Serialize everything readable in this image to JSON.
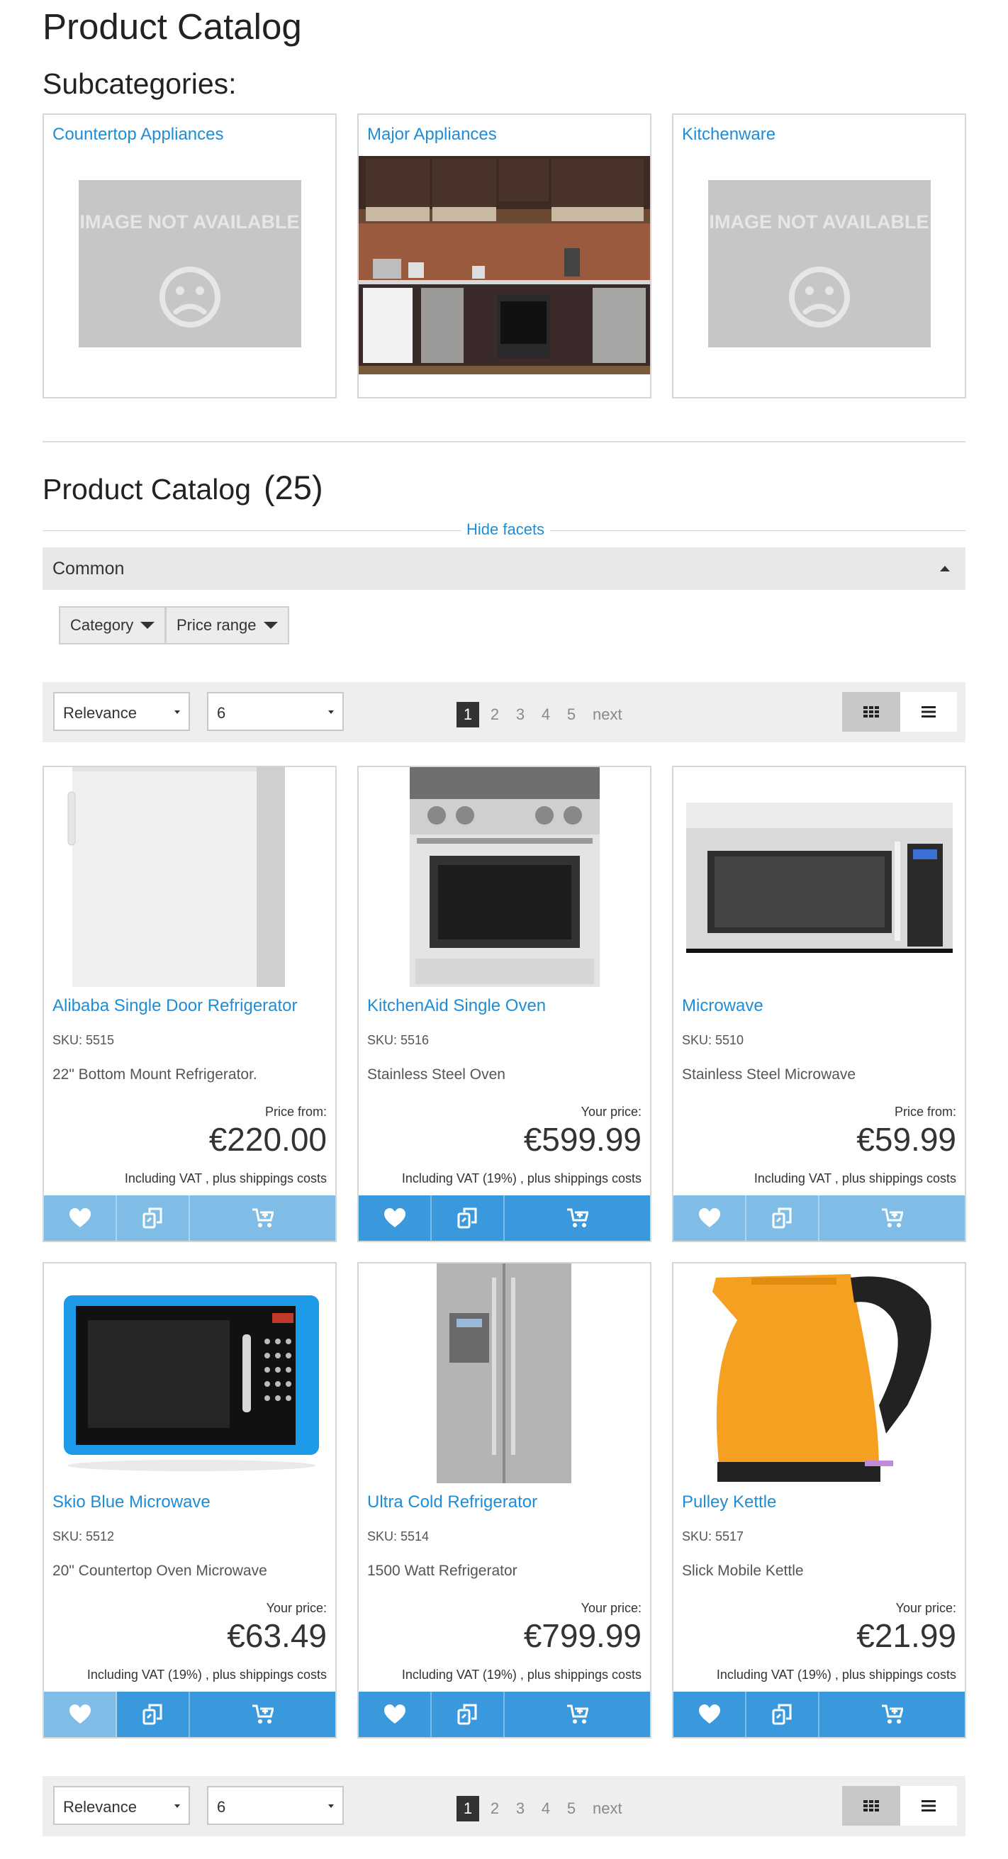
{
  "page_title": "Product Catalog",
  "subcategories_title": "Subcategories:",
  "subcategories": [
    {
      "name": "Countertop Appliances",
      "image": "not-available"
    },
    {
      "name": "Major Appliances",
      "image": "kitchen-photo"
    },
    {
      "name": "Kitchenware",
      "image": "not-available"
    }
  ],
  "image_not_available": "IMAGE NOT AVAILABLE",
  "catalog": {
    "heading": "Product Catalog",
    "count": "(25)"
  },
  "facets": {
    "hide_label": "Hide facets",
    "group_label": "Common",
    "buttons": [
      "Category",
      "Price range"
    ]
  },
  "toolbar": {
    "sort_value": "Relevance",
    "per_page_value": "6",
    "pages": [
      "1",
      "2",
      "3",
      "4",
      "5"
    ],
    "active_page": "1",
    "next_label": "next"
  },
  "products": [
    {
      "name": "Alibaba Single Door Refrigerator",
      "sku": "SKU: 5515",
      "description": "22\" Bottom Mount Refrigerator.",
      "price_label": "Price from:",
      "price": "€220.00",
      "vat_text": "Including VAT , plus shippings costs",
      "image": "white-fridge"
    },
    {
      "name": "KitchenAid Single Oven",
      "sku": "SKU: 5516",
      "description": "Stainless Steel Oven",
      "price_label": "Your price:",
      "price": "€599.99",
      "vat_text": "Including VAT (19%) , plus shippings costs",
      "image": "steel-oven"
    },
    {
      "name": "Microwave",
      "sku": "SKU: 5510",
      "description": "Stainless Steel Microwave",
      "price_label": "Price from:",
      "price": "€59.99",
      "vat_text": "Including VAT , plus shippings costs",
      "image": "steel-microwave"
    },
    {
      "name": "Skio Blue Microwave",
      "sku": "SKU: 5512",
      "description": "20\" Countertop Oven Microwave",
      "price_label": "Your price:",
      "price": "€63.49",
      "vat_text": "Including VAT (19%) , plus shippings costs",
      "image": "blue-microwave"
    },
    {
      "name": "Ultra Cold Refrigerator",
      "sku": "SKU: 5514",
      "description": "1500 Watt Refrigerator",
      "price_label": "Your price:",
      "price": "€799.99",
      "vat_text": "Including VAT (19%) , plus shippings costs",
      "image": "steel-fridge"
    },
    {
      "name": "Pulley Kettle",
      "sku": "SKU: 5517",
      "description": "Slick Mobile Kettle",
      "price_label": "Your price:",
      "price": "€21.99",
      "vat_text": "Including VAT (19%) , plus shippings costs",
      "image": "orange-kettle"
    }
  ],
  "colors": {
    "link": "#1f8dd6",
    "action_dark": "#3a98dc",
    "action_light": "#7fbde6"
  }
}
